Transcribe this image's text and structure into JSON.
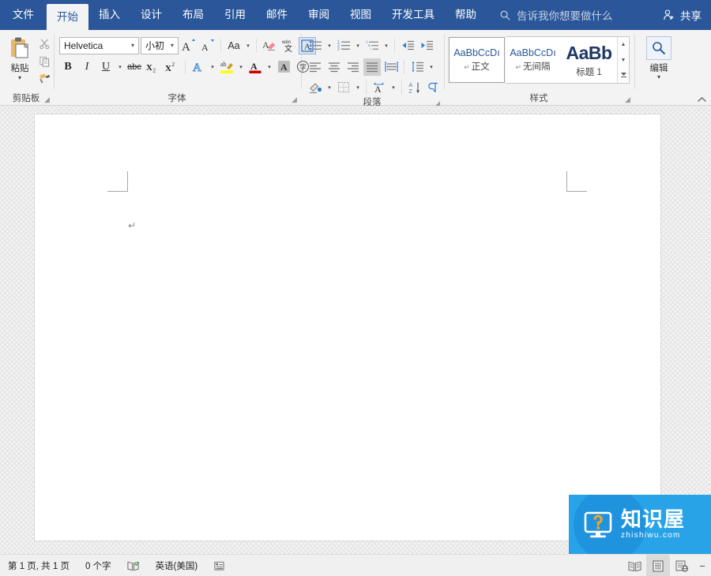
{
  "app": {
    "title": "Microsoft Word",
    "accent_blue": "#2b579a",
    "ribbon_bg": "#f3f3f3"
  },
  "tabs": [
    {
      "label": "文件",
      "active": false,
      "name": "tab-file"
    },
    {
      "label": "开始",
      "active": true,
      "name": "tab-home"
    },
    {
      "label": "插入",
      "active": false,
      "name": "tab-insert"
    },
    {
      "label": "设计",
      "active": false,
      "name": "tab-design"
    },
    {
      "label": "布局",
      "active": false,
      "name": "tab-layout"
    },
    {
      "label": "引用",
      "active": false,
      "name": "tab-references"
    },
    {
      "label": "邮件",
      "active": false,
      "name": "tab-mailings"
    },
    {
      "label": "审阅",
      "active": false,
      "name": "tab-review"
    },
    {
      "label": "视图",
      "active": false,
      "name": "tab-view"
    },
    {
      "label": "开发工具",
      "active": false,
      "name": "tab-developer"
    },
    {
      "label": "帮助",
      "active": false,
      "name": "tab-help"
    }
  ],
  "tellme": {
    "placeholder": "告诉我你想要做什么",
    "icon": "search-icon"
  },
  "share": {
    "label": "共享",
    "icon": "share-person-icon"
  },
  "ribbon": {
    "clipboard": {
      "label": "剪贴板",
      "paste": {
        "label": "粘贴",
        "icon": "clipboard-paste-icon",
        "dropdown": "▾"
      },
      "cut": {
        "tooltip": "剪切",
        "icon": "scissors-icon"
      },
      "copy": {
        "tooltip": "复制",
        "icon": "copy-icon"
      },
      "format_painter": {
        "tooltip": "格式刷",
        "icon": "format-painter-icon"
      },
      "launcher": "◢"
    },
    "font": {
      "label": "字体",
      "font_name": {
        "value": "Helvetica",
        "caret": "▾"
      },
      "font_size": {
        "value": "小初",
        "caret": "▾"
      },
      "grow_font": {
        "label": "A",
        "icon": "grow-font-icon"
      },
      "shrink_font": {
        "label": "A",
        "icon": "shrink-font-icon"
      },
      "change_case": {
        "label": "Aa",
        "icon": "change-case-icon",
        "caret": "▾"
      },
      "clear_formatting": {
        "icon": "clear-formatting-icon"
      },
      "phonetic_guide": {
        "label": "wén",
        "sub": "文",
        "icon": "phonetic-guide-icon"
      },
      "character_border": {
        "label": "A",
        "icon": "character-border-icon",
        "selected": true
      },
      "bold": {
        "label": "B",
        "icon": "bold-icon"
      },
      "italic": {
        "label": "I",
        "icon": "italic-icon"
      },
      "underline": {
        "label": "U",
        "icon": "underline-icon",
        "caret": "▾"
      },
      "strikethrough": {
        "label": "abc",
        "icon": "strikethrough-icon"
      },
      "subscript": {
        "label": "X₂",
        "icon": "subscript-icon"
      },
      "superscript": {
        "label": "X²",
        "icon": "superscript-icon"
      },
      "text_effects": {
        "label": "A",
        "icon": "text-effects-icon",
        "caret": "▾"
      },
      "highlight": {
        "label": "ab",
        "icon": "highlight-color-icon",
        "caret": "▾",
        "color": "#ffff00"
      },
      "font_color": {
        "label": "A",
        "icon": "font-color-icon",
        "caret": "▾",
        "color": "#cc0000"
      },
      "shading": {
        "label": "A",
        "icon": "character-shading-icon"
      },
      "enclose": {
        "label": "宰",
        "icon": "enclose-characters-icon"
      },
      "launcher": "◢"
    },
    "paragraph": {
      "label": "段落",
      "bullets": {
        "icon": "bullet-list-icon",
        "caret": "▾"
      },
      "numbering": {
        "icon": "numbered-list-icon",
        "caret": "▾"
      },
      "multilevel": {
        "icon": "multilevel-list-icon",
        "caret": "▾"
      },
      "decrease_indent": {
        "icon": "decrease-indent-icon"
      },
      "increase_indent": {
        "icon": "increase-indent-icon"
      },
      "align_left": {
        "icon": "align-left-icon"
      },
      "align_center": {
        "icon": "align-center-icon"
      },
      "align_right": {
        "icon": "align-right-icon"
      },
      "justify": {
        "icon": "justify-icon",
        "active": true
      },
      "distribute": {
        "icon": "distribute-text-icon"
      },
      "line_spacing": {
        "icon": "line-spacing-icon",
        "caret": "▾"
      },
      "shading": {
        "icon": "paragraph-shading-icon",
        "caret": "▾"
      },
      "borders": {
        "icon": "borders-icon",
        "caret": "▾"
      },
      "asian_layout": {
        "icon": "asian-layout-icon",
        "caret": "▾"
      },
      "sort": {
        "icon": "sort-icon"
      },
      "show_marks": {
        "icon": "show-paragraph-marks-icon"
      },
      "launcher": "◢"
    },
    "styles": {
      "label": "样式",
      "items": [
        {
          "preview": "AaBbCcDı",
          "name": "正文",
          "mark": "↵",
          "active": true,
          "big": false
        },
        {
          "preview": "AaBbCcDı",
          "name": "无间隔",
          "mark": "↵",
          "active": false,
          "big": false
        },
        {
          "preview": "AaBb",
          "name": "标题 1",
          "mark": "",
          "active": false,
          "big": true
        }
      ],
      "scroll_up": "▲",
      "scroll_down": "▼",
      "scroll_more": "▼",
      "launcher": "◢"
    },
    "editing": {
      "label": "编辑",
      "icon": "magnifier-icon",
      "caret": "▾"
    },
    "collapse": {
      "icon": "chevron-up-icon",
      "label": "︿"
    }
  },
  "document": {
    "paragraph_mark": "↵",
    "margin_mark_color": "#a6a6a6"
  },
  "watermark": {
    "cn": "知识屋",
    "en": "zhishiwu.com",
    "icon": "monitor-question-icon",
    "bg": "#29a3e8"
  },
  "statusbar": {
    "page_info": "第 1 页, 共 1 页",
    "word_count": "0 个字",
    "proofing_icon": "proofing-errors-icon",
    "language": "英语(美国)",
    "accessibility_icon": "accessibility-icon",
    "views": [
      {
        "name": "view-read-mode",
        "icon": "read-mode-icon",
        "active": false
      },
      {
        "name": "view-print-layout",
        "icon": "print-layout-icon",
        "active": true
      },
      {
        "name": "view-web-layout",
        "icon": "web-layout-icon",
        "active": false
      }
    ],
    "zoom_out": "−"
  }
}
